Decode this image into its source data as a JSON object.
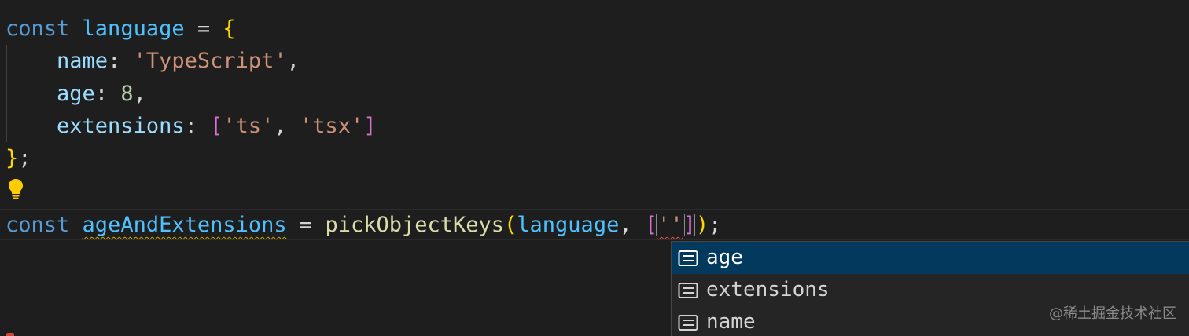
{
  "code": {
    "line1": {
      "kw": "const",
      "name": "language",
      "op": "=",
      "brace": "{"
    },
    "line2": {
      "prop": "name",
      "colon": ":",
      "value": "'TypeScript'",
      "comma": ","
    },
    "line3": {
      "prop": "age",
      "colon": ":",
      "value": "8",
      "comma": ","
    },
    "line4": {
      "prop": "extensions",
      "colon": ":",
      "open": "[",
      "v1": "'ts'",
      "sep": ",",
      "v2": "'tsx'",
      "close": "]"
    },
    "line5": {
      "brace": "}",
      "semi": ";"
    },
    "line7": {
      "kw": "const",
      "name": "ageAndExtensions",
      "op": "=",
      "fn": "pickObjectKeys",
      "paren_open": "(",
      "arg1": "language",
      "comma": ",",
      "bracket_open": "[",
      "str": "''",
      "bracket_close": "]",
      "paren_close": ")",
      "semi": ";"
    }
  },
  "suggestions": {
    "items": [
      {
        "label": "age",
        "icon": "field-icon",
        "selected": true
      },
      {
        "label": "extensions",
        "icon": "field-icon",
        "selected": false
      },
      {
        "label": "name",
        "icon": "field-icon",
        "selected": false
      }
    ]
  },
  "watermark": "@稀土掘金技术社区",
  "colors": {
    "background": "#1e1e1e",
    "keyword": "#569cd6",
    "variable": "#4fc1ff",
    "property": "#9cdcfe",
    "string": "#ce9178",
    "number": "#b5cea8",
    "function": "#dcdcaa",
    "suggest_selected": "#04395e",
    "lightbulb": "#ffcc00"
  }
}
